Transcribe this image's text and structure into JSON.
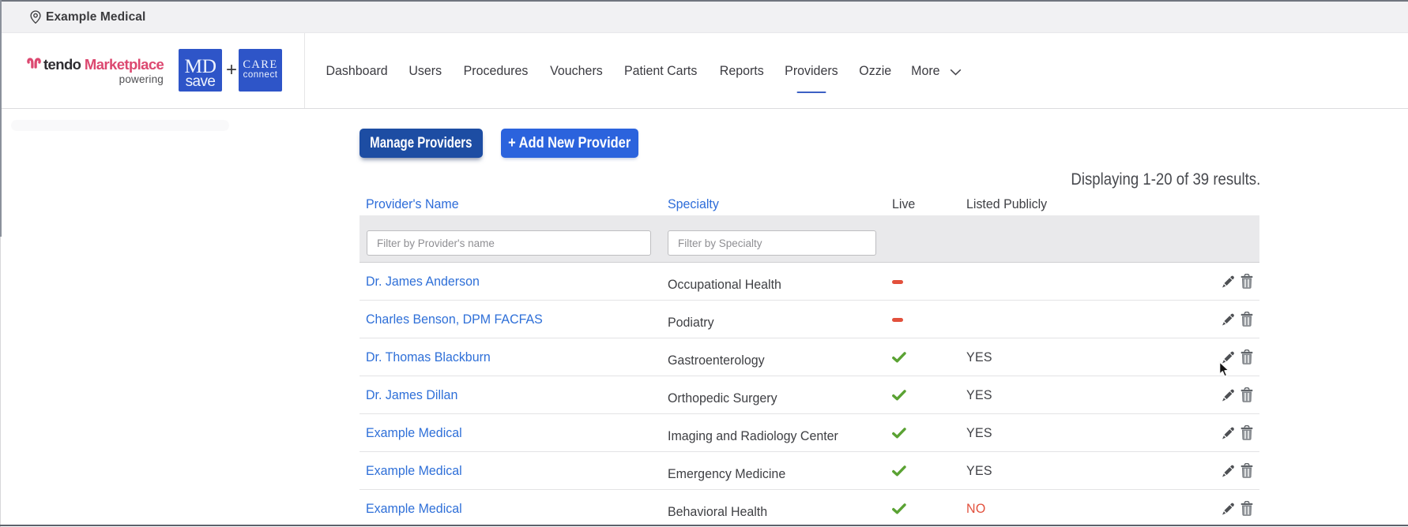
{
  "topbar": {
    "location_label": "Example Medical"
  },
  "brand": {
    "tendo": "tendo",
    "marketplace": "Marketplace",
    "powering": "powering",
    "mdsave_top": "MD",
    "mdsave_bottom": "save",
    "plus": "+",
    "care_top": "CARE",
    "care_bottom": "connect"
  },
  "nav": {
    "items": [
      {
        "label": "Dashboard",
        "active": false
      },
      {
        "label": "Users",
        "active": false
      },
      {
        "label": "Procedures",
        "active": false
      },
      {
        "label": "Vouchers",
        "active": false
      },
      {
        "label": "Patient Carts",
        "active": false
      },
      {
        "label": "Reports",
        "active": false
      },
      {
        "label": "Providers",
        "active": true
      },
      {
        "label": "Ozzie",
        "active": false
      },
      {
        "label": "More",
        "active": false,
        "chevron": true
      }
    ]
  },
  "toolbar": {
    "manage_label": "Manage Providers",
    "add_label": "+ Add New Provider"
  },
  "results_summary": "Displaying 1-20 of 39 results.",
  "table": {
    "columns": {
      "name": "Provider's Name",
      "specialty": "Specialty",
      "live": "Live",
      "listed": "Listed Publicly"
    },
    "filters": {
      "name_placeholder": "Filter by Provider's name",
      "specialty_placeholder": "Filter by Specialty"
    },
    "rows": [
      {
        "name": "Dr. James Anderson",
        "specialty": "Occupational Health",
        "live": false,
        "listed": ""
      },
      {
        "name": "Charles Benson, DPM FACFAS",
        "specialty": "Podiatry",
        "live": false,
        "listed": ""
      },
      {
        "name": "Dr. Thomas Blackburn",
        "specialty": "Gastroenterology",
        "live": true,
        "listed": "YES"
      },
      {
        "name": "Dr. James Dillan",
        "specialty": "Orthopedic Surgery",
        "live": true,
        "listed": "YES"
      },
      {
        "name": "Example Medical",
        "specialty": "Imaging and Radiology Center",
        "live": true,
        "listed": "YES"
      },
      {
        "name": "Example Medical",
        "specialty": "Emergency Medicine",
        "live": true,
        "listed": "YES"
      },
      {
        "name": "Example Medical",
        "specialty": "Behavioral Health",
        "live": true,
        "listed": "NO"
      }
    ]
  },
  "colors": {
    "brand_pink": "#dc4870",
    "logo_blue": "#2e55c8",
    "link_blue": "#2d6cd9",
    "active_tab_blue": "#2e5ecf",
    "button_dark_blue": "#1d4da3",
    "button_blue": "#2b63dd",
    "live_green": "#5aa233",
    "alert_red": "#e2503c"
  }
}
